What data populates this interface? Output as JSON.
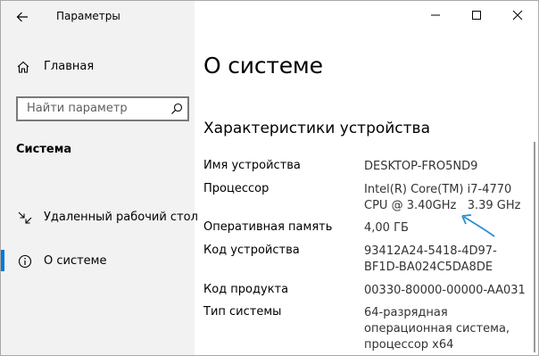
{
  "window": {
    "app_title": "Параметры",
    "icons": {
      "back": "back-arrow-icon",
      "minimize": "minimize-icon",
      "maximize": "maximize-icon",
      "close": "close-icon"
    }
  },
  "sidebar": {
    "home_label": "Главная",
    "search_placeholder": "Найти параметр",
    "section_title": "Система",
    "items": [
      {
        "label": "Удаленный рабочий стол",
        "icon": "remote-desktop-icon",
        "selected": false
      },
      {
        "label": "О системе",
        "icon": "info-icon",
        "selected": true
      }
    ]
  },
  "main": {
    "title": "О системе",
    "section": "Характеристики устройства",
    "specs": [
      {
        "label": "Имя устройства",
        "value": [
          "DESKTOP-FRO5ND9"
        ]
      },
      {
        "label": "Процессор",
        "value": [
          "Intel(R) Core(TM) i7-4770",
          "CPU @ 3.40GHz   3.39 GHz"
        ]
      },
      {
        "label": "Оперативная память",
        "value": [
          "4,00 ГБ"
        ]
      },
      {
        "label": "Код устройства",
        "value": [
          "93412A24-5418-4D97-",
          "BF1D-BA024C5DA8DE"
        ]
      },
      {
        "label": "Код продукта",
        "value": [
          "00330-80000-00000-AA031"
        ]
      },
      {
        "label": "Тип системы",
        "value": [
          "64-разрядная",
          "операционная система,",
          "процессор x64"
        ]
      }
    ]
  },
  "colors": {
    "accent": "#0078d7",
    "sidebar_bg": "#f2f2f2",
    "annotation_arrow": "#2a8fd0"
  }
}
